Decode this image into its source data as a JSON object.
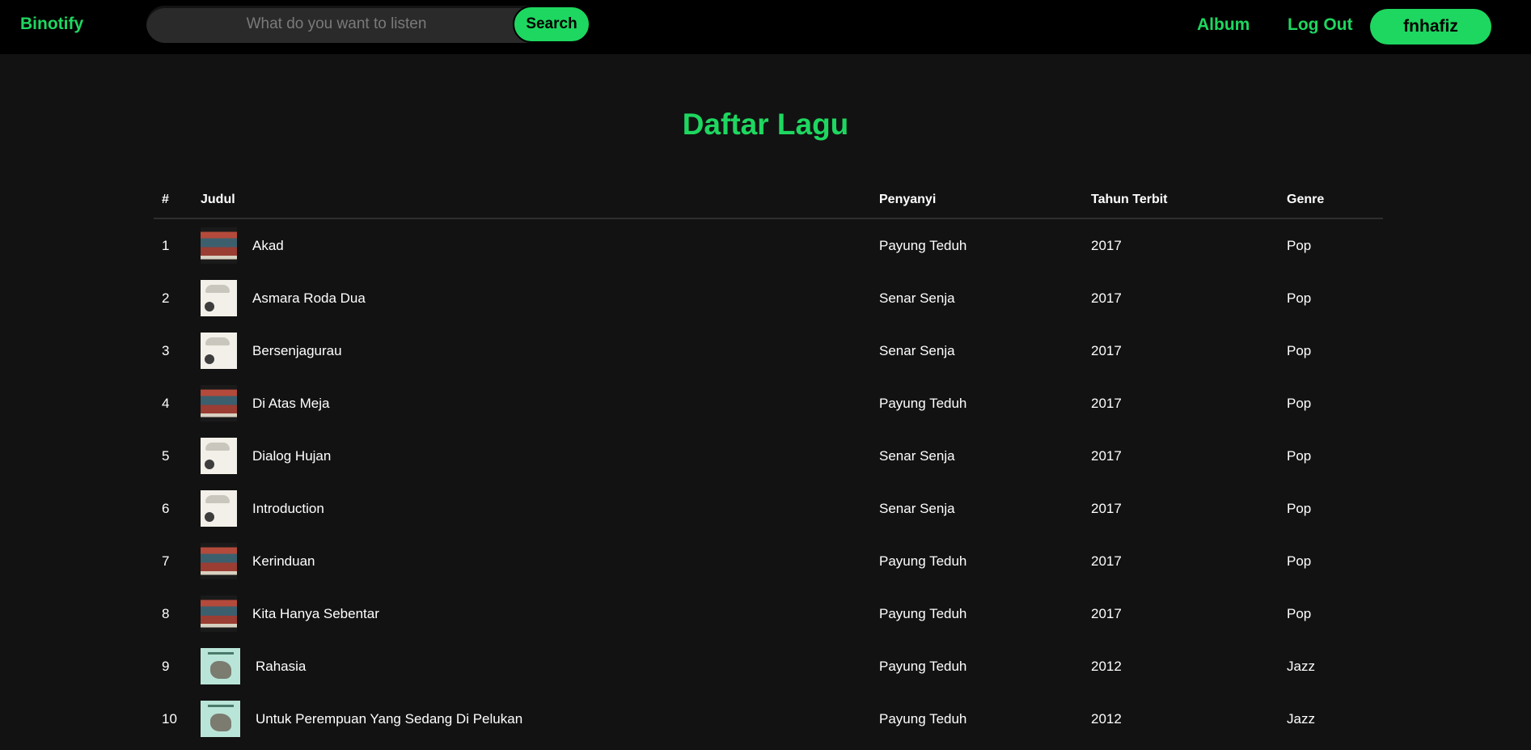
{
  "nav": {
    "brand": "Binotify",
    "search_placeholder": "What do you want to listen",
    "search_button": "Search",
    "album_link": "Album",
    "logout_link": "Log Out",
    "username": "fnhafiz"
  },
  "page_title": "Daftar Lagu",
  "table": {
    "headers": {
      "num": "#",
      "title": "Judul",
      "singer": "Penyanyi",
      "year": "Tahun Terbit",
      "genre": "Genre"
    },
    "rows": [
      {
        "num": "1",
        "title": "Akad",
        "singer": "Payung Teduh",
        "year": "2017",
        "genre": "Pop",
        "cover_icon": "album-cover-a"
      },
      {
        "num": "2",
        "title": "Asmara Roda Dua",
        "singer": "Senar Senja",
        "year": "2017",
        "genre": "Pop",
        "cover_icon": "album-cover-b"
      },
      {
        "num": "3",
        "title": "Bersenjagurau",
        "singer": "Senar Senja",
        "year": "2017",
        "genre": "Pop",
        "cover_icon": "album-cover-b"
      },
      {
        "num": "4",
        "title": "Di Atas Meja",
        "singer": "Payung Teduh",
        "year": "2017",
        "genre": "Pop",
        "cover_icon": "album-cover-a"
      },
      {
        "num": "5",
        "title": "Dialog Hujan",
        "singer": "Senar Senja",
        "year": "2017",
        "genre": "Pop",
        "cover_icon": "album-cover-b"
      },
      {
        "num": "6",
        "title": "Introduction",
        "singer": "Senar Senja",
        "year": "2017",
        "genre": "Pop",
        "cover_icon": "album-cover-b"
      },
      {
        "num": "7",
        "title": "Kerinduan",
        "singer": "Payung Teduh",
        "year": "2017",
        "genre": "Pop",
        "cover_icon": "album-cover-a"
      },
      {
        "num": "8",
        "title": "Kita Hanya Sebentar",
        "singer": "Payung Teduh",
        "year": "2017",
        "genre": "Pop",
        "cover_icon": "album-cover-a"
      },
      {
        "num": "9",
        "title": "Rahasia",
        "singer": "Payung Teduh",
        "year": "2012",
        "genre": "Jazz",
        "cover_icon": "album-cover-c"
      },
      {
        "num": "10",
        "title": "Untuk Perempuan Yang Sedang Di Pelukan",
        "singer": "Payung Teduh",
        "year": "2012",
        "genre": "Jazz",
        "cover_icon": "album-cover-c"
      }
    ]
  },
  "colors": {
    "accent": "#1ed760",
    "background": "#121212",
    "navbar": "#000000"
  }
}
